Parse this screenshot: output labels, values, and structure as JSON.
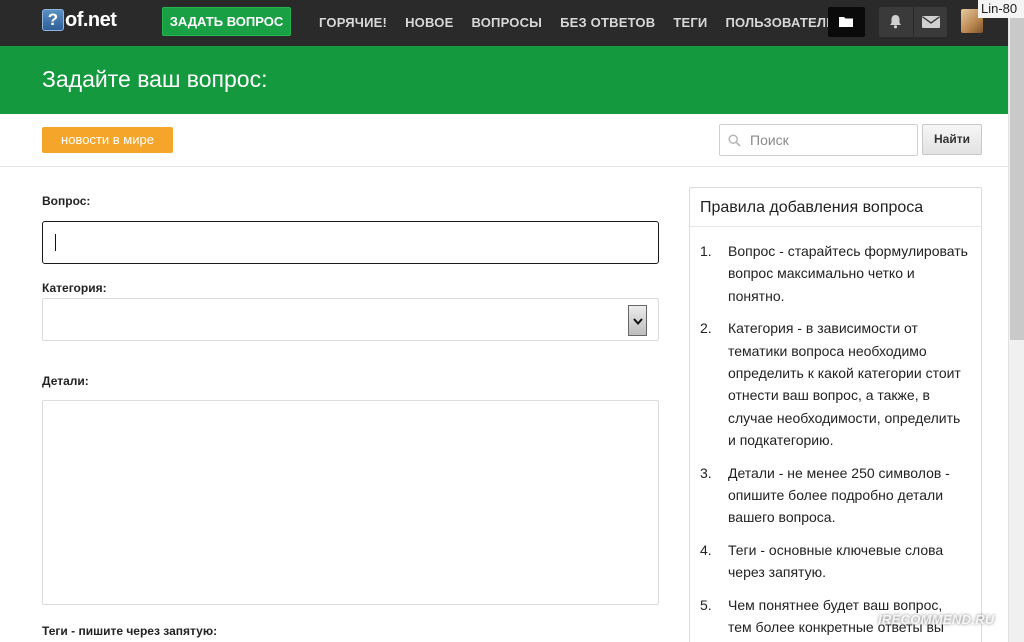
{
  "header": {
    "logo_icon": "?",
    "logo_text": "of.net",
    "ask_button": "ЗАДАТЬ ВОПРОС",
    "nav": [
      "ГОРЯЧИЕ!",
      "НОВОЕ",
      "ВОПРОСЫ",
      "БЕЗ ОТВЕТОВ",
      "ТЕГИ",
      "ПОЛЬЗОВАТЕЛИ"
    ],
    "icons": [
      "folder-icon",
      "bell-icon",
      "envelope-icon"
    ],
    "username": "Lin-80"
  },
  "banner": {
    "title": "Задайте ваш вопрос:"
  },
  "toolbar": {
    "news_button": "новости в мире",
    "search_placeholder": "Поиск",
    "search_value": "",
    "find_button": "Найти"
  },
  "form": {
    "question_label": "Вопрос:",
    "question_value": "",
    "category_label": "Категория:",
    "category_value": "",
    "details_label": "Детали:",
    "details_value": "",
    "tags_label": "Теги - пишите через запятую:"
  },
  "rules": {
    "title": "Правила добавления вопроса",
    "items": [
      {
        "num": "1.",
        "text": "Вопрос - старайтесь формулировать вопрос максимально четко и понятно."
      },
      {
        "num": "2.",
        "text": "Категория - в зависимости от тематики вопроса необходимо определить к какой категории стоит отнести ваш вопрос, а также, в случае необходимости, определить и подкатегорию."
      },
      {
        "num": "3.",
        "text": "Детали - не менее 250 символов - опишите более подробно детали вашего вопроса."
      },
      {
        "num": "4.",
        "text": "Теги - основные ключевые слова через запятую."
      },
      {
        "num": "5.",
        "text": "Чем понятнее будет ваш вопрос, тем более конкретные ответы вы"
      }
    ]
  },
  "watermark": "IRECOMMEND.RU",
  "colors": {
    "navbar": "#2a2a2a",
    "brand_green": "#14993e",
    "ask_button": "#1aa044",
    "news_button": "#f5a52a"
  }
}
